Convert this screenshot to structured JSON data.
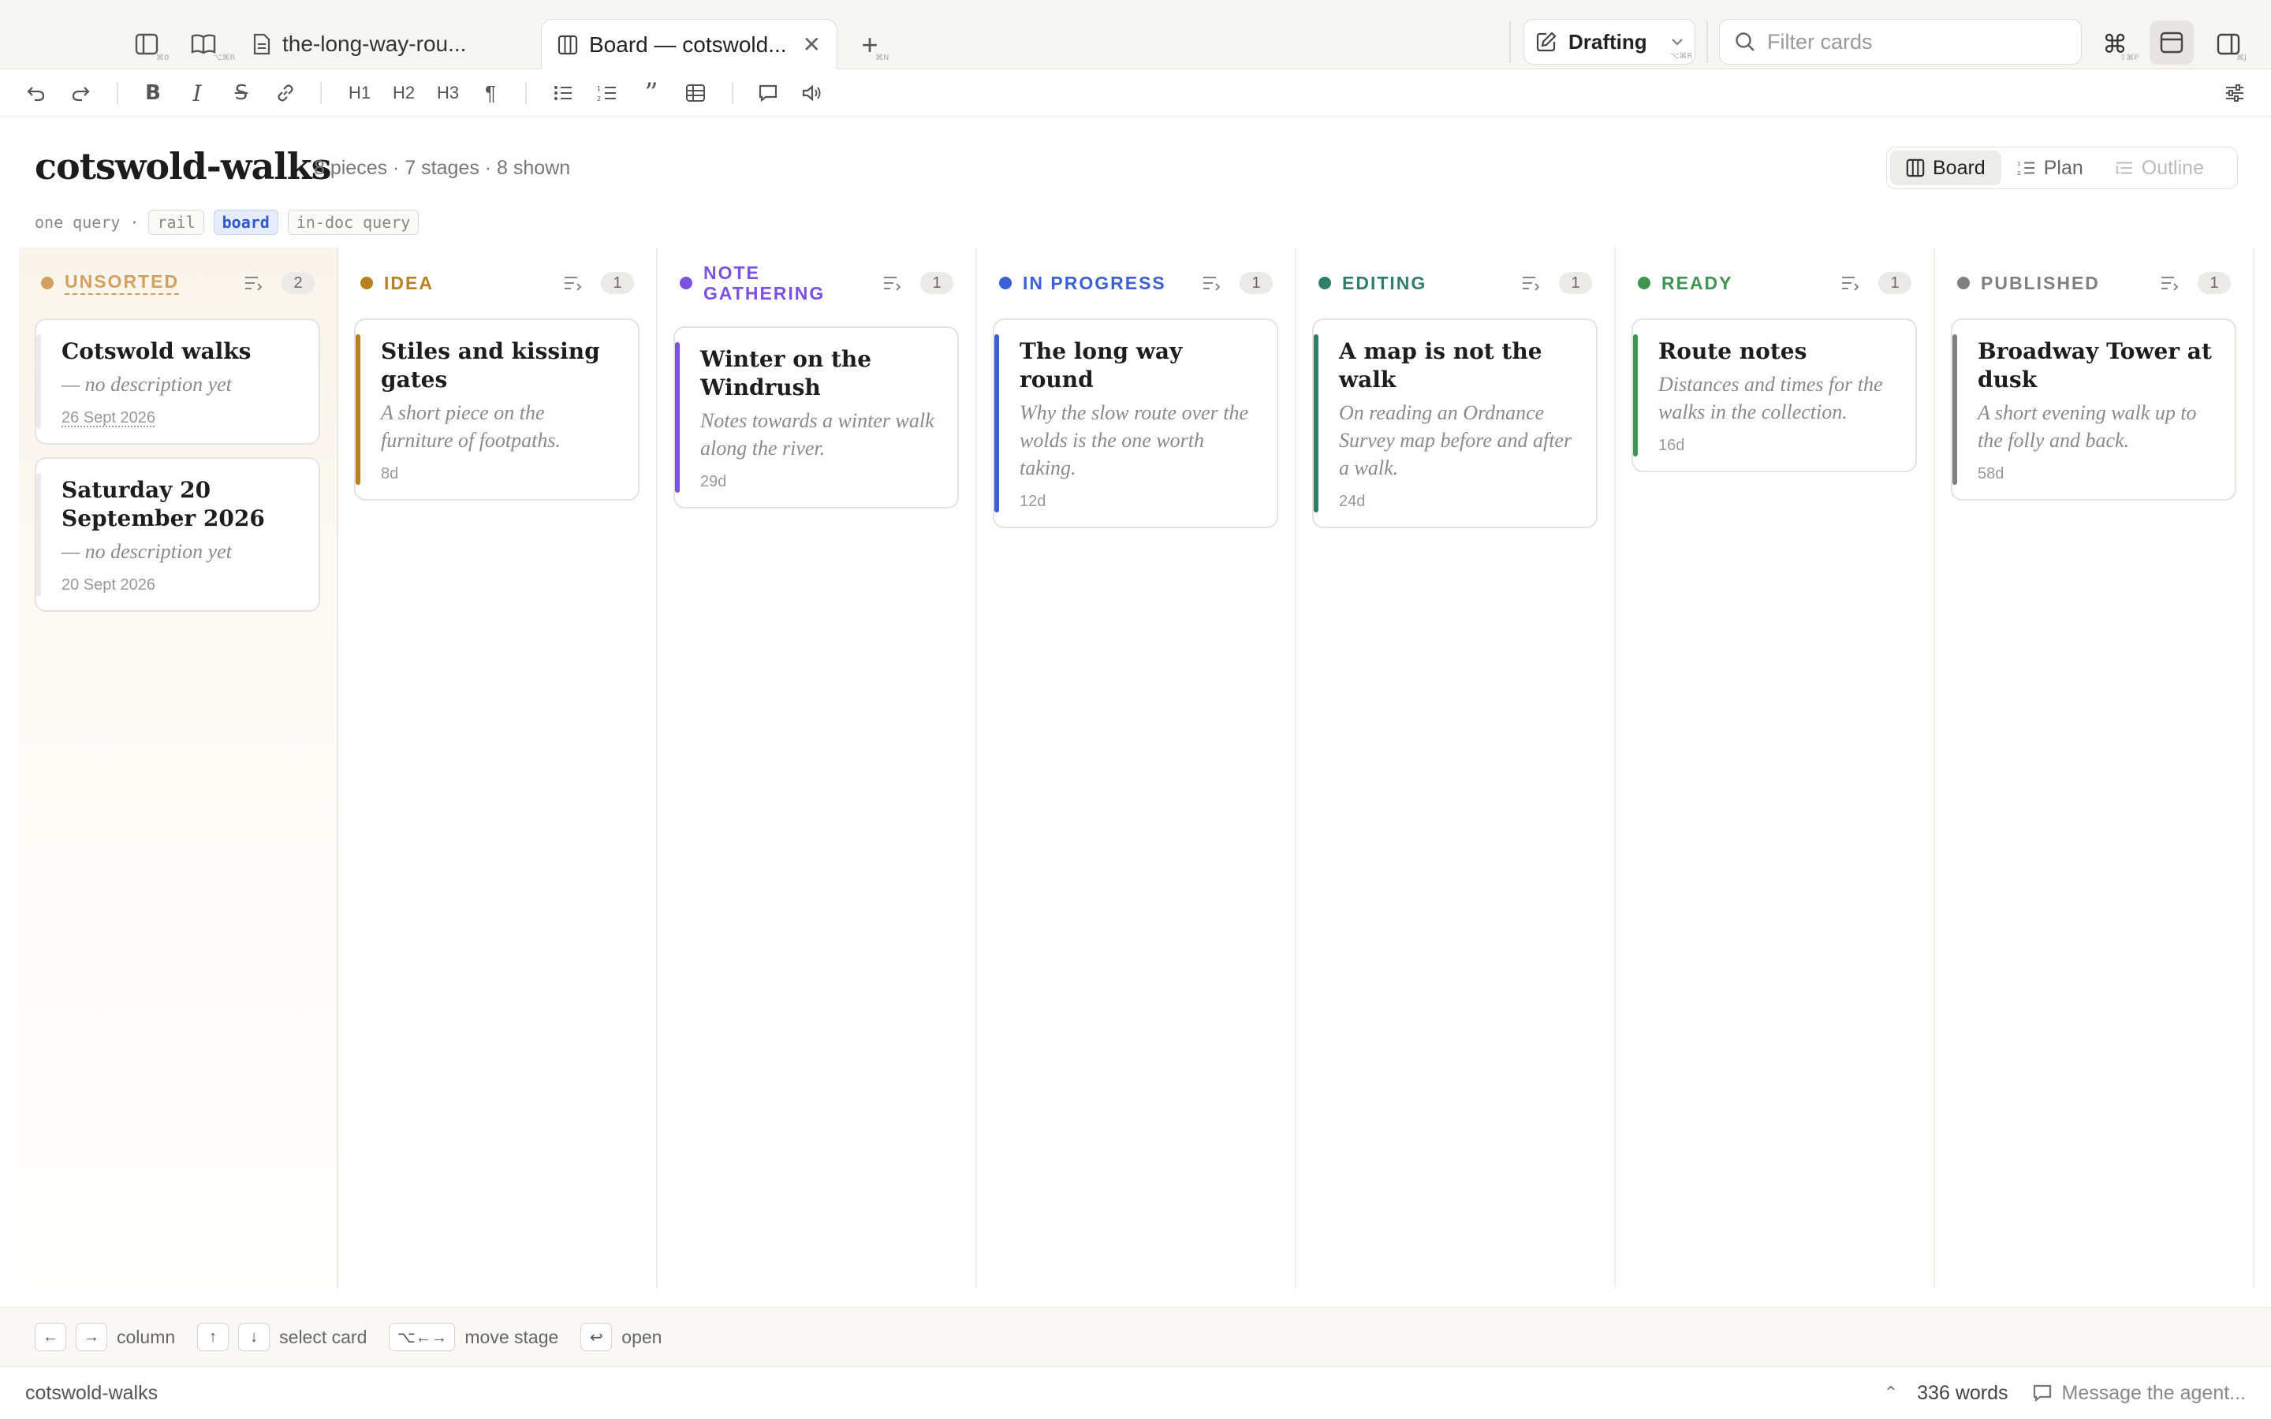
{
  "tabs": {
    "doc_tab_label": "the-long-way-rou...",
    "board_tab_label": "Board — cotswold...",
    "new_tab_shortcut": "⌘N",
    "sidebar_shortcut": "⌘0",
    "reader_shortcut": "⌥⌘R"
  },
  "mode": {
    "label": "Drafting",
    "shortcut": "⌥⌘R"
  },
  "filter": {
    "placeholder": "Filter cards"
  },
  "command_shortcut": "⇧⌘P",
  "right_shortcut": "⌘J",
  "toolbar": {
    "h1": "H1",
    "h2": "H2",
    "h3": "H3"
  },
  "header": {
    "title": "cotswold-walks",
    "meta": "8 pieces · 7 stages · 8 shown",
    "query_prefix": "one query ·",
    "chips": [
      "rail",
      "board",
      "in-doc query"
    ]
  },
  "views": {
    "board": "Board",
    "plan": "Plan",
    "outline": "Outline"
  },
  "columns": [
    {
      "name": "UNSORTED",
      "color": "#d2a05f",
      "count": "2",
      "cards": [
        {
          "title": "Cotswold walks",
          "desc": "— no description yet",
          "date": "26 Sept 2026"
        },
        {
          "title": "Saturday 20 September 2026",
          "desc": "— no description yet",
          "date": "20 Sept 2026"
        }
      ]
    },
    {
      "name": "IDEA",
      "color": "#b8801f",
      "count": "1",
      "cards": [
        {
          "title": "Stiles and kissing gates",
          "desc": "A short piece on the furniture of footpaths.",
          "date": "8d"
        }
      ]
    },
    {
      "name": "NOTE GATHERING",
      "color": "#7b52e0",
      "count": "1",
      "cards": [
        {
          "title": "Winter on the Windrush",
          "desc": "Notes towards a winter walk along the river.",
          "date": "29d"
        }
      ]
    },
    {
      "name": "IN PROGRESS",
      "color": "#3a5fd6",
      "count": "1",
      "cards": [
        {
          "title": "The long way round",
          "desc": "Why the slow route over the wolds is the one worth taking.",
          "date": "12d"
        }
      ]
    },
    {
      "name": "EDITING",
      "color": "#2f7f68",
      "count": "1",
      "cards": [
        {
          "title": "A map is not the walk",
          "desc": "On reading an Ordnance Survey map before and after a walk.",
          "date": "24d"
        }
      ]
    },
    {
      "name": "READY",
      "color": "#3f9452",
      "count": "1",
      "cards": [
        {
          "title": "Route notes",
          "desc": "Distances and times for the walks in the collection.",
          "date": "16d"
        }
      ]
    },
    {
      "name": "PUBLISHED",
      "color": "#808080",
      "count": "1",
      "cards": [
        {
          "title": "Broadway Tower at dusk",
          "desc": "A short evening walk up to the folly and back.",
          "date": "58d"
        }
      ]
    }
  ],
  "hints": {
    "left_key": "←",
    "right_key": "→",
    "column": "column",
    "up_key": "↑",
    "down_key": "↓",
    "select_card": "select card",
    "move_key": "⌥←→",
    "move_stage": "move stage",
    "enter_key": "↩",
    "open": "open"
  },
  "status": {
    "doc": "cotswold-walks",
    "words": "336 words",
    "agent_placeholder": "Message the agent..."
  }
}
